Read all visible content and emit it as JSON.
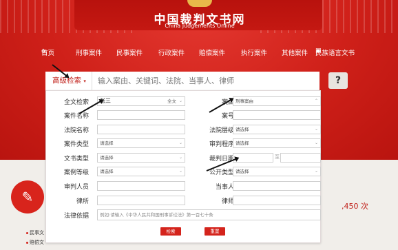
{
  "site": {
    "title": "中国裁判文书网",
    "subtitle": "China Judgements Online"
  },
  "nav": {
    "home": "首页",
    "items": [
      "刑事案件",
      "民事案件",
      "行政案件",
      "赔偿案件",
      "执行案件",
      "其他案件",
      "民族语言文书"
    ]
  },
  "search": {
    "advanced_label": "高级检索",
    "placeholder": "输入案由、关键词、法院、当事人、律师",
    "help": "?"
  },
  "form": {
    "fulltext": {
      "label": "全文检索",
      "value": "张三",
      "scope": "全文"
    },
    "cause": {
      "label": "案由",
      "value": "刑事案由"
    },
    "case_name": {
      "label": "案件名称",
      "value": ""
    },
    "case_no": {
      "label": "案号",
      "value": ""
    },
    "court_name": {
      "label": "法院名称",
      "value": ""
    },
    "court_level": {
      "label": "法院层级",
      "value": "请选择"
    },
    "case_type": {
      "label": "案件类型",
      "value": "请选择"
    },
    "trial_procedure": {
      "label": "审判程序",
      "value": "请选择"
    },
    "doc_type": {
      "label": "文书类型",
      "value": "请选择"
    },
    "judge_date": {
      "label": "裁判日期",
      "separator": "至",
      "from": "",
      "to": ""
    },
    "case_level": {
      "label": "案例等级",
      "value": "请选择"
    },
    "public_type": {
      "label": "公开类型",
      "value": "请选择"
    },
    "judge_person": {
      "label": "审判人员",
      "value": ""
    },
    "party": {
      "label": "当事人",
      "value": ""
    },
    "law_firm": {
      "label": "律所",
      "value": ""
    },
    "lawyer": {
      "label": "律师",
      "value": ""
    },
    "legal_basis": {
      "label": "法律依据",
      "placeholder": "例如:请输入《中华人民共和国刑事诉讼法》第一百七十条"
    },
    "search_button": "检索",
    "reset_button": "重置"
  },
  "stats": {
    "count_text": ",450 次"
  },
  "bottom": {
    "items": [
      "民事文",
      "赔偿文"
    ]
  },
  "colors": {
    "brand_red": "#c81e17",
    "button_red": "#d4241c"
  }
}
